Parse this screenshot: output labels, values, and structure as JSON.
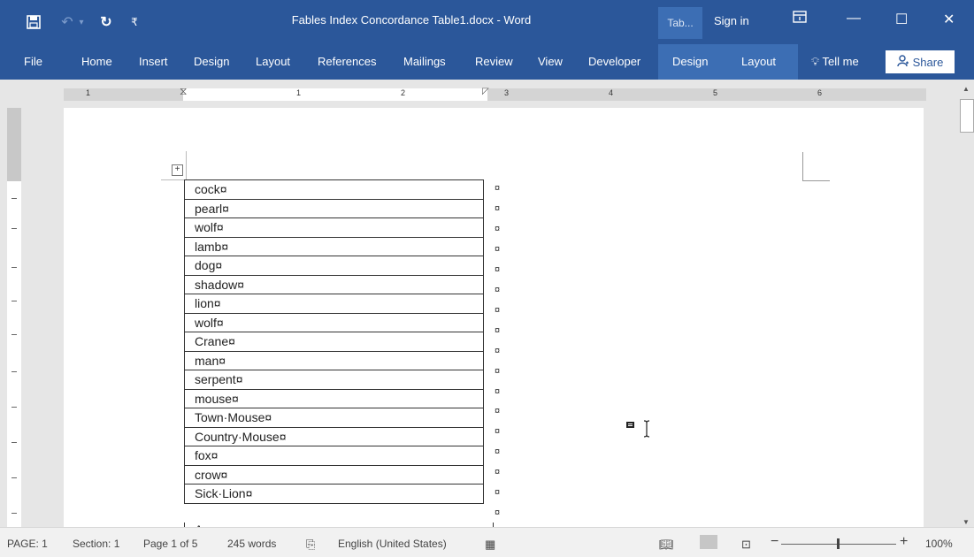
{
  "titlebar": {
    "document_title": "Fables Index Concordance Table1.docx - Word",
    "context_tab_label": "Tab...",
    "signin_label": "Sign in",
    "save_icon": "save-icon",
    "undo_icon": "undo-icon",
    "redo_icon": "redo-icon",
    "customize_icon": "qat-dropdown-icon",
    "ribbon_display_icon": "ribbon-display-icon",
    "minimize_glyph": "—",
    "maximize_glyph": "☐",
    "close_glyph": "✕"
  },
  "ribbon": {
    "tabs": [
      "File",
      "Home",
      "Insert",
      "Design",
      "Layout",
      "References",
      "Mailings",
      "Review",
      "View",
      "Developer"
    ],
    "context_tabs": [
      "Design",
      "Layout"
    ],
    "tellme_label": "Tell me",
    "share_label": "Share"
  },
  "ruler": {
    "numbers": [
      "1",
      "1",
      "2",
      "3",
      "4",
      "5",
      "6"
    ]
  },
  "table_rows": [
    "cock¤",
    "pearl¤",
    "wolf¤",
    "lamb¤",
    "dog¤",
    "shadow¤",
    "lion¤",
    "wolf¤",
    "Crane¤",
    "man¤",
    "serpent¤",
    "mouse¤",
    "Town·Mouse¤",
    "Country·Mouse¤",
    "fox¤",
    "crow¤",
    "Sick·Lion¤"
  ],
  "row_end_mark": "¤",
  "partial_row_text": "Ass¤",
  "status": {
    "page": "PAGE: 1",
    "section": "Section: 1",
    "page_of": "Page 1 of 5",
    "words": "245 words",
    "language": "English (United States)",
    "zoom": "100%"
  },
  "colors": {
    "accent": "#2b579a",
    "context_band": "#3c6eb4"
  }
}
